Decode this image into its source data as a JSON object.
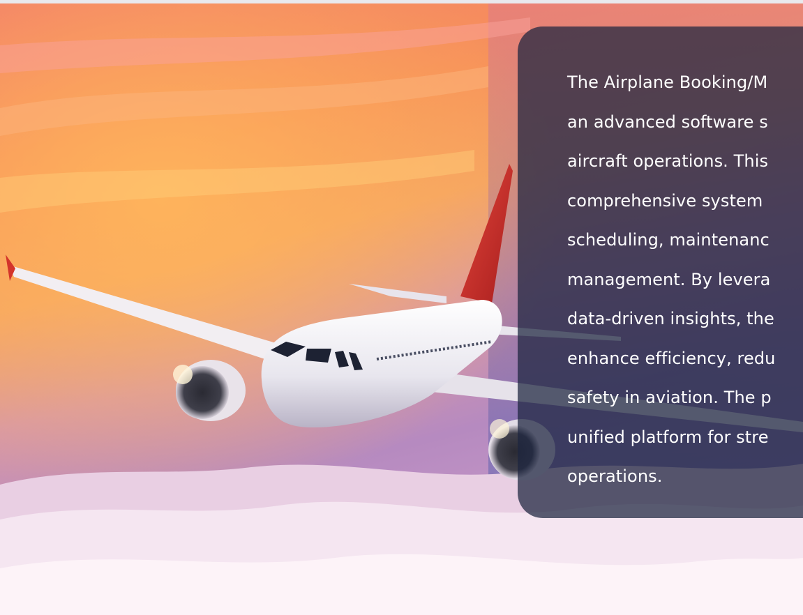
{
  "hero": {
    "image": "airplane-flying-above-sunset-clouds",
    "colors": {
      "sky_top": "#f7835e",
      "sky_mid": "#f59a52",
      "sky_low": "#b88ab8",
      "cloud": "#f4e9f2",
      "tail": "#d8342a",
      "fuselage": "#f3f3f6"
    }
  },
  "info_card": {
    "lines": [
      "The Airplane Booking/M",
      "an advanced software s",
      "aircraft operations. This",
      "comprehensive system",
      "scheduling, maintenanc",
      "management. By levera",
      "data-driven insights, the",
      "enhance efficiency, redu",
      "safety in aviation. The p",
      "unified platform for stre",
      "operations."
    ],
    "background": "#1c243e"
  }
}
